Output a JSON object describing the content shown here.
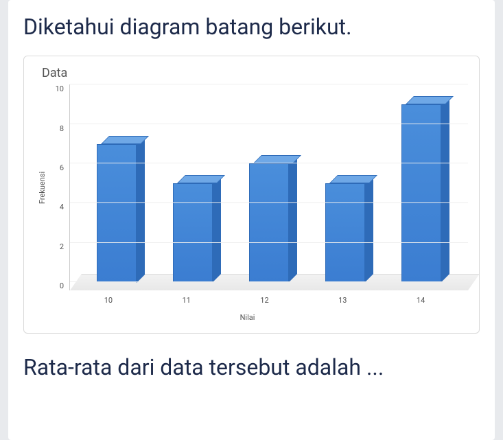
{
  "prompt_before": "Diketahui diagram batang berikut.",
  "prompt_after": "Rata-rata dari data tersebut adalah ...",
  "chart_data": {
    "type": "bar",
    "title": "Data",
    "xlabel": "Nilai",
    "ylabel": "Frekuensi",
    "categories": [
      "10",
      "11",
      "12",
      "13",
      "14"
    ],
    "values": [
      7,
      5,
      6,
      5,
      9
    ],
    "yticks": [
      10,
      8,
      6,
      4,
      2,
      0
    ],
    "ylim": [
      0,
      10
    ]
  }
}
